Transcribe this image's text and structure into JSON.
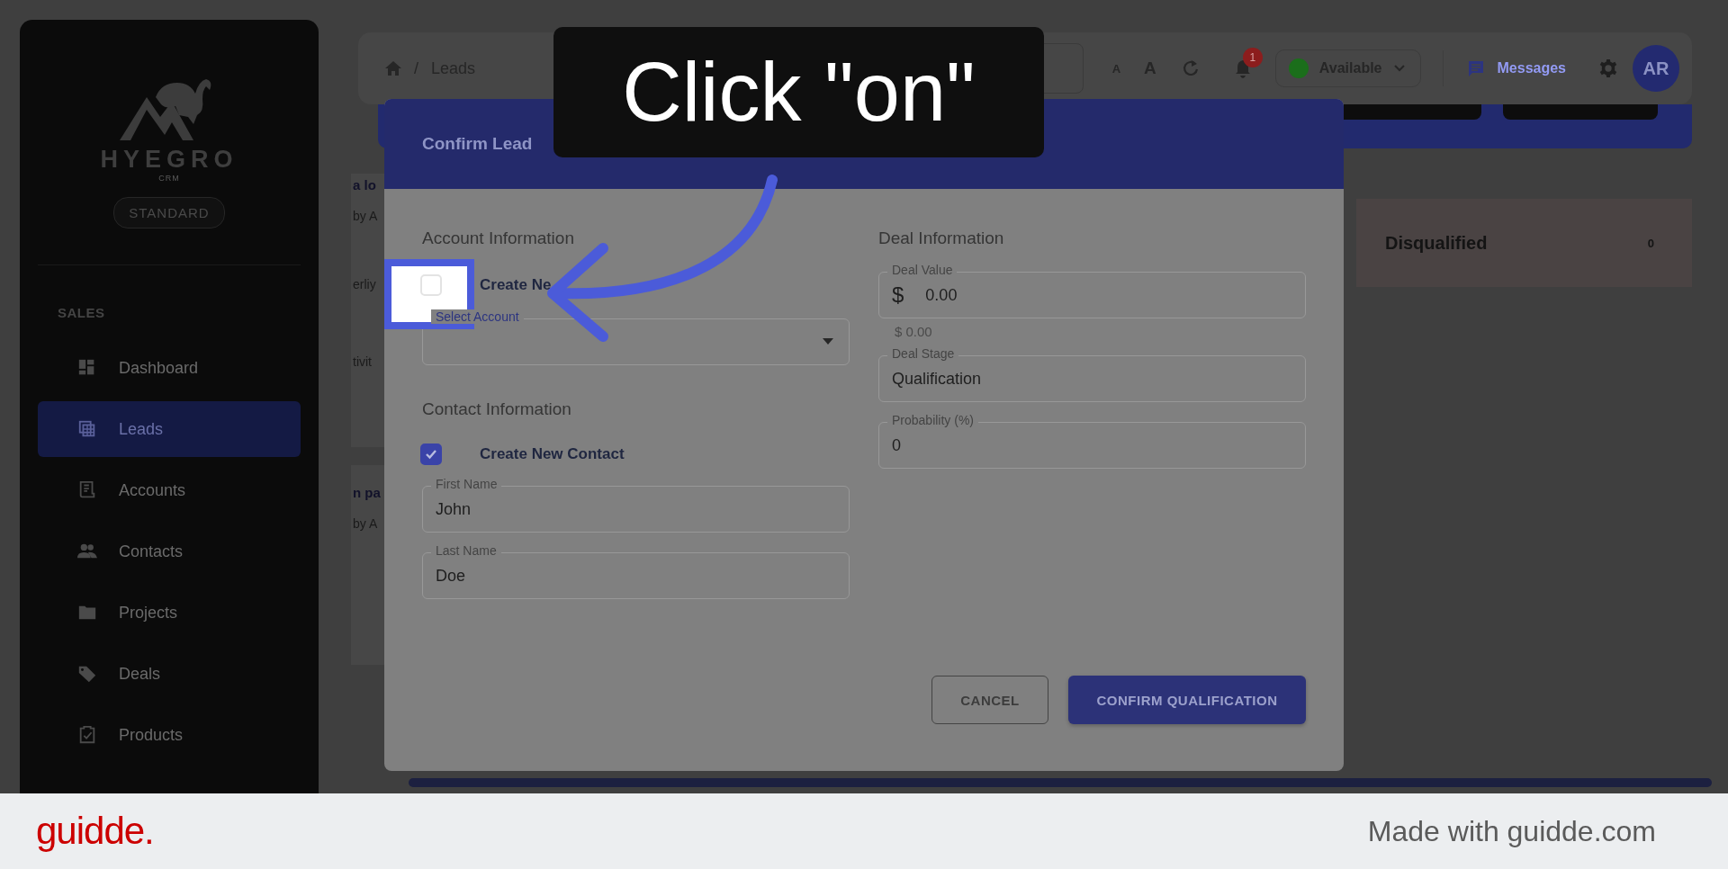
{
  "sidebar": {
    "logo": {
      "name": "HYEGRO",
      "tagline": "CRM"
    },
    "plan": "STANDARD",
    "section": "SALES",
    "items": [
      {
        "label": "Dashboard",
        "selected": false
      },
      {
        "label": "Leads",
        "selected": true
      },
      {
        "label": "Accounts",
        "selected": false
      },
      {
        "label": "Contacts",
        "selected": false
      },
      {
        "label": "Projects",
        "selected": false
      },
      {
        "label": "Deals",
        "selected": false
      },
      {
        "label": "Products",
        "selected": false
      }
    ]
  },
  "topbar": {
    "separator": "/",
    "breadcrumb": "Leads",
    "font_small": "A",
    "font_large": "A",
    "notifications": "1",
    "status": {
      "label": "Available",
      "color": "#1b6e1b"
    },
    "messages": "Messages",
    "avatar": "AR"
  },
  "background": {
    "card_fragments": [
      [
        "a lo",
        "by A",
        "erliy",
        "tivit"
      ],
      [
        "n pa",
        "by A"
      ]
    ],
    "stage": {
      "label": "Disqualified",
      "count": "0"
    }
  },
  "modal": {
    "title": "Confirm Lead",
    "account": {
      "heading": "Account Information",
      "checkbox": {
        "label": "Create Ne",
        "checked": false
      },
      "select": {
        "label": "Select Account"
      }
    },
    "contact": {
      "heading": "Contact Information",
      "checkbox": {
        "label": "Create New Contact",
        "checked": true
      },
      "fields": [
        {
          "label": "First Name",
          "value": "John"
        },
        {
          "label": "Last Name",
          "value": "Doe"
        }
      ]
    },
    "deal": {
      "heading": "Deal Information",
      "fields": [
        {
          "label": "Deal Value",
          "prefix": "$",
          "value": "0.00",
          "helper": "$ 0.00"
        },
        {
          "label": "Deal Stage",
          "value": "Qualification"
        },
        {
          "label": "Probability (%)",
          "value": "0"
        }
      ]
    },
    "buttons": [
      {
        "label": "CANCEL",
        "kind": "outlined"
      },
      {
        "label": "CONFIRM QUALIFICATION",
        "kind": "contained"
      }
    ]
  },
  "tooltip": {
    "text": "Click \"on\""
  },
  "footer": {
    "brand": "guidde.",
    "credit": "Made with guidde.com"
  }
}
